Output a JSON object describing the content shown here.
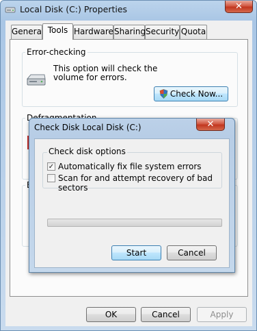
{
  "window": {
    "title": "Local Disk (C:) Properties",
    "close_glyph": "✕"
  },
  "tabs": [
    {
      "label": "General",
      "active": false
    },
    {
      "label": "Tools",
      "active": true
    },
    {
      "label": "Hardware",
      "active": false
    },
    {
      "label": "Sharing",
      "active": false
    },
    {
      "label": "Security",
      "active": false
    },
    {
      "label": "Quota",
      "active": false
    }
  ],
  "error_checking": {
    "group_label": "Error-checking",
    "description": "This option will check the volume for errors.",
    "check_now_label": "Check Now..."
  },
  "defrag": {
    "group_label": "Defragmentation"
  },
  "backup": {
    "group_label_fragment": "B"
  },
  "footer": {
    "ok_label": "OK",
    "cancel_label": "Cancel",
    "apply_label": "Apply"
  },
  "dialog": {
    "title": "Check Disk Local Disk (C:)",
    "close_glyph": "✕",
    "group_label": "Check disk options",
    "options": [
      {
        "label": "Automatically fix file system errors",
        "checked": true
      },
      {
        "label": "Scan for and attempt recovery of bad sectors",
        "checked": false
      }
    ],
    "progress": 0,
    "start_label": "Start",
    "cancel_label": "Cancel"
  },
  "icons": {
    "title": "drive-icon",
    "error_check": "hard-drive-icon",
    "check_now": "uac-shield-icon"
  },
  "colors": {
    "progress": "#37b24d",
    "close": "#c2371f",
    "focus_border": "#3c7fb1"
  }
}
